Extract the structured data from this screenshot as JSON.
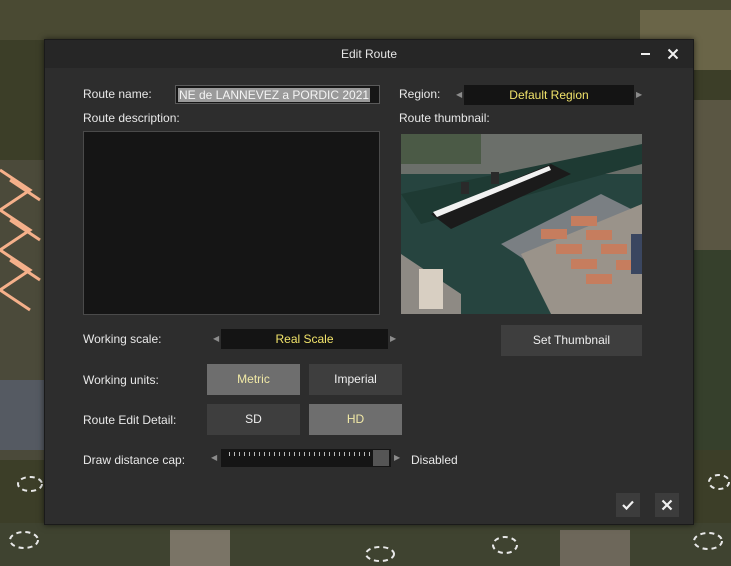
{
  "dialog": {
    "title": "Edit Route",
    "minimize_icon": "minus",
    "close_icon": "x"
  },
  "form": {
    "route_name_label": "Route name:",
    "route_name_value": "NE de LANNEVEZ a PORDIC 2021",
    "region_label": "Region:",
    "region_value": "Default Region",
    "description_label": "Route description:",
    "description_value": "",
    "thumbnail_label": "Route thumbnail:",
    "working_scale_label": "Working scale:",
    "working_scale_value": "Real Scale",
    "set_thumbnail_label": "Set Thumbnail",
    "working_units_label": "Working units:",
    "units_options": [
      "Metric",
      "Imperial"
    ],
    "units_selected": "Metric",
    "edit_detail_label": "Route Edit Detail:",
    "detail_options": [
      "SD",
      "HD"
    ],
    "detail_selected": "HD",
    "draw_distance_label": "Draw distance cap:",
    "draw_distance_value": "Disabled"
  },
  "footer": {
    "ok_icon": "checkmark",
    "cancel_icon": "x"
  },
  "colors": {
    "accent_yellow": "#f1e36a",
    "dialog_bg": "#2d2d2d"
  }
}
